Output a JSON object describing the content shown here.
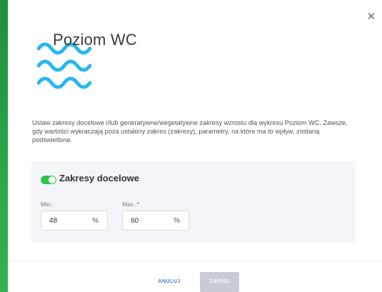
{
  "dialog": {
    "title": "Poziom WC",
    "icon": "water-waves-icon",
    "close_icon": "close-icon",
    "description": "Ustaw zakresy docelowe i/lub generatywne/wegetatywne zakresy wzrostu dla wykresu Poziom WC. Zawsze, gdy wartości wykraczają poza ustalony zakres (zakresy), parametry, na które ma to wpływ, zostaną podświetlone."
  },
  "target_ranges": {
    "toggle_on": true,
    "title": "Zakresy docelowe",
    "min": {
      "label": "Min.:",
      "value": "48",
      "unit": "%"
    },
    "max": {
      "label": "Max.:*",
      "value": "60",
      "unit": "%"
    }
  },
  "footer": {
    "cancel_label": "ANULUJ",
    "save_label": "ZAPISZ"
  },
  "colors": {
    "accent_blue": "#3a7bd5",
    "wave_blue": "#29b6f0",
    "toggle_green": "#2ec24f",
    "disabled_gray": "#c8ccd2"
  }
}
